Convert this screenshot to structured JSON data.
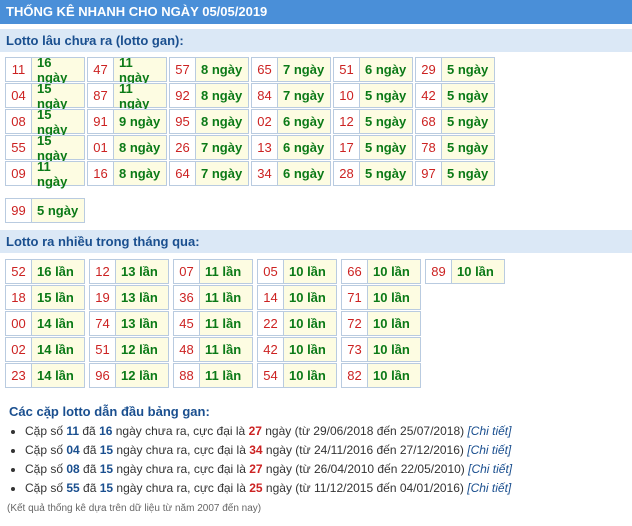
{
  "title": "THỐNG KÊ NHANH CHO NGÀY 05/05/2019",
  "gan_section_title": "Lotto lâu chưa ra (lotto gan):",
  "gan": [
    [
      [
        "11",
        "16 ngày"
      ],
      [
        "04",
        "15 ngày"
      ],
      [
        "08",
        "15 ngày"
      ],
      [
        "55",
        "15 ngày"
      ],
      [
        "09",
        "11 ngày"
      ]
    ],
    [
      [
        "47",
        "11 ngày"
      ],
      [
        "87",
        "11 ngày"
      ],
      [
        "91",
        "9 ngày"
      ],
      [
        "01",
        "8 ngày"
      ],
      [
        "16",
        "8 ngày"
      ]
    ],
    [
      [
        "57",
        "8 ngày"
      ],
      [
        "92",
        "8 ngày"
      ],
      [
        "95",
        "8 ngày"
      ],
      [
        "26",
        "7 ngày"
      ],
      [
        "64",
        "7 ngày"
      ]
    ],
    [
      [
        "65",
        "7 ngày"
      ],
      [
        "84",
        "7 ngày"
      ],
      [
        "02",
        "6 ngày"
      ],
      [
        "13",
        "6 ngày"
      ],
      [
        "34",
        "6 ngày"
      ]
    ],
    [
      [
        "51",
        "6 ngày"
      ],
      [
        "10",
        "5 ngày"
      ],
      [
        "12",
        "5 ngày"
      ],
      [
        "17",
        "5 ngày"
      ],
      [
        "28",
        "5 ngày"
      ]
    ],
    [
      [
        "29",
        "5 ngày"
      ],
      [
        "42",
        "5 ngày"
      ],
      [
        "68",
        "5 ngày"
      ],
      [
        "78",
        "5 ngày"
      ],
      [
        "97",
        "5 ngày"
      ]
    ],
    [
      [
        "99",
        "5 ngày"
      ]
    ]
  ],
  "frequent_section_title": "Lotto ra nhiều trong tháng qua:",
  "frequent": [
    [
      [
        "52",
        "16 lần"
      ],
      [
        "18",
        "15 lần"
      ],
      [
        "00",
        "14 lần"
      ],
      [
        "02",
        "14 lần"
      ],
      [
        "23",
        "14 lần"
      ]
    ],
    [
      [
        "12",
        "13 lần"
      ],
      [
        "19",
        "13 lần"
      ],
      [
        "74",
        "13 lần"
      ],
      [
        "51",
        "12 lần"
      ],
      [
        "96",
        "12 lần"
      ]
    ],
    [
      [
        "07",
        "11 lần"
      ],
      [
        "36",
        "11 lần"
      ],
      [
        "45",
        "11 lần"
      ],
      [
        "48",
        "11 lần"
      ],
      [
        "88",
        "11 lần"
      ]
    ],
    [
      [
        "05",
        "10 lần"
      ],
      [
        "14",
        "10 lần"
      ],
      [
        "22",
        "10 lần"
      ],
      [
        "42",
        "10 lần"
      ],
      [
        "54",
        "10 lần"
      ]
    ],
    [
      [
        "66",
        "10 lần"
      ],
      [
        "71",
        "10 lần"
      ],
      [
        "72",
        "10 lần"
      ],
      [
        "73",
        "10 lần"
      ],
      [
        "82",
        "10 lần"
      ]
    ],
    [
      [
        "89",
        "10 lần"
      ]
    ]
  ],
  "pairs_title": "Các cặp lotto dẫn đầu bảng gan:",
  "pairs": [
    {
      "prefix": "Cặp số ",
      "num": "11",
      "mid1": " đã ",
      "days": "16",
      "mid2": " ngày chưa ra, cực đại là ",
      "max": "27",
      "mid3": " ngày (từ 29/06/2018 đến 25/07/2018) ",
      "link": "[Chi tiết]"
    },
    {
      "prefix": "Cặp số ",
      "num": "04",
      "mid1": " đã ",
      "days": "15",
      "mid2": " ngày chưa ra, cực đại là ",
      "max": "34",
      "mid3": " ngày (từ 24/11/2016 đến 27/12/2016) ",
      "link": "[Chi tiết]"
    },
    {
      "prefix": "Cặp số ",
      "num": "08",
      "mid1": " đã ",
      "days": "15",
      "mid2": " ngày chưa ra, cực đại là ",
      "max": "27",
      "mid3": " ngày (từ 26/04/2010 đến 22/05/2010) ",
      "link": "[Chi tiết]"
    },
    {
      "prefix": "Cặp số ",
      "num": "55",
      "mid1": " đã ",
      "days": "15",
      "mid2": " ngày chưa ra, cực đại là ",
      "max": "25",
      "mid3": " ngày (từ 11/12/2015 đến 04/01/2016) ",
      "link": "[Chi tiết]"
    }
  ],
  "footnote": "(Kết quả thống kê dựa trên dữ liệu từ năm 2007 đến nay)",
  "colors": {
    "header": "#4a8fd8",
    "section": "#dbe8f6",
    "number": "#cc2222",
    "value": "#0b7a17",
    "link": "#1a4f8f"
  }
}
